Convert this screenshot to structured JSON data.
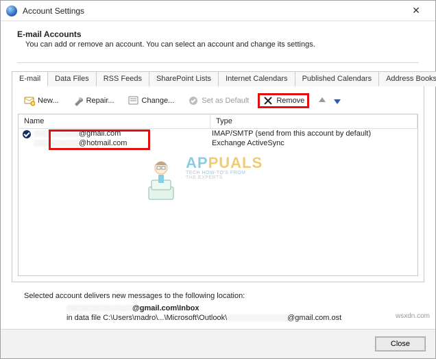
{
  "window": {
    "title": "Account Settings"
  },
  "header": {
    "title": "E-mail Accounts",
    "description": "You can add or remove an account. You can select an account and change its settings."
  },
  "tabs": [
    {
      "label": "E-mail",
      "active": true
    },
    {
      "label": "Data Files"
    },
    {
      "label": "RSS Feeds"
    },
    {
      "label": "SharePoint Lists"
    },
    {
      "label": "Internet Calendars"
    },
    {
      "label": "Published Calendars"
    },
    {
      "label": "Address Books"
    }
  ],
  "toolbar": {
    "new_label": "New...",
    "repair_label": "Repair...",
    "change_label": "Change...",
    "default_label": "Set as Default",
    "remove_label": "Remove"
  },
  "list": {
    "col_name": "Name",
    "col_type": "Type",
    "rows": [
      {
        "name_suffix": "@gmail.com",
        "type": "IMAP/SMTP (send from this account by default)",
        "default": true
      },
      {
        "name_suffix": "@hotmail.com",
        "type": "Exchange ActiveSync",
        "default": false
      }
    ]
  },
  "watermark": {
    "brand_a": "AP",
    "brand_b": "PUALS",
    "tag1": "TECH HOW-TO'S FROM",
    "tag2": "THE EXPERTS"
  },
  "delivery": {
    "intro": "Selected account delivers new messages to the following location:",
    "loc_suffix": "@gmail.com\\Inbox",
    "path_prefix": "in data file C:\\Users\\madro\\...\\Microsoft\\Outlook\\",
    "path_suffix": "@gmail.com.ost"
  },
  "footer": {
    "close_label": "Close"
  },
  "source": "wsxdn.com"
}
